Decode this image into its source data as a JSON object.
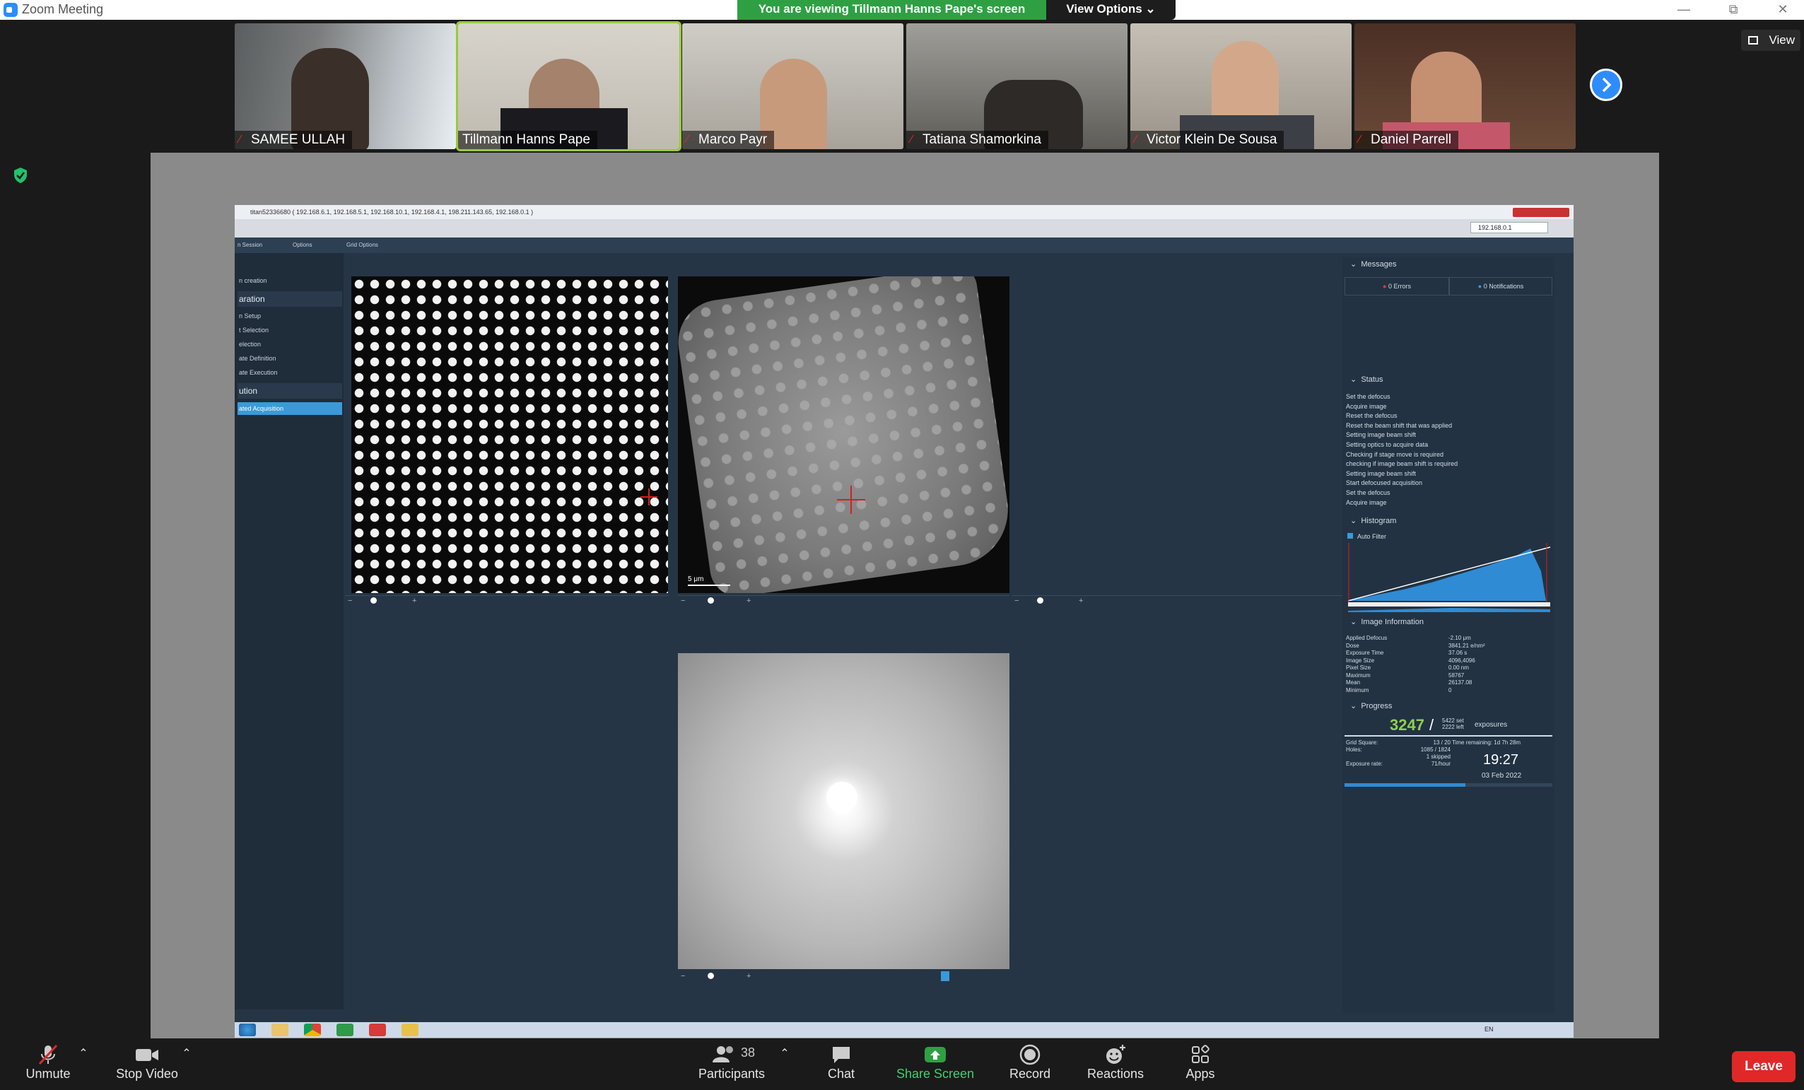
{
  "titlebar": {
    "app_title": "Zoom Meeting"
  },
  "banner": {
    "text": "You are viewing Tillmann Hanns Pape's screen",
    "view_options": "View Options ⌄"
  },
  "participants_strip": [
    {
      "name": "SAMEE ULLAH",
      "muted": true
    },
    {
      "name": "Tillmann Hanns Pape",
      "muted": false
    },
    {
      "name": "Marco Payr",
      "muted": true
    },
    {
      "name": "Tatiana Shamorkina",
      "muted": true
    },
    {
      "name": "Victor Klein De Sousa",
      "muted": true
    },
    {
      "name": "Daniel Parrell",
      "muted": true
    }
  ],
  "view_button": "View",
  "shared": {
    "window_title": "titan52336680 ( 192.168.6.1, 192.168.5.1, 192.168.10.1, 192.168.4.1, 198.211.143.65, 192.168.0.1 )",
    "ip_field": "192.168.0.1",
    "tabs": [
      "n Session",
      "Options",
      "Grid Options"
    ],
    "sidebar": [
      {
        "label": "n creation",
        "type": "item"
      },
      {
        "label": "aration",
        "type": "header"
      },
      {
        "label": "n Setup",
        "type": "item"
      },
      {
        "label": "t Selection",
        "type": "item"
      },
      {
        "label": "election",
        "type": "item"
      },
      {
        "label": "ate Definition",
        "type": "item"
      },
      {
        "label": "ate Execution",
        "type": "item"
      },
      {
        "label": "ution",
        "type": "header"
      },
      {
        "label": "ated Acquisition",
        "type": "selected"
      }
    ],
    "panel_scale_1": "5 μm",
    "messages": {
      "header": "Messages",
      "errors": "0 Errors",
      "notifications": "0 Notifications"
    },
    "status": {
      "header": "Status",
      "lines": [
        "Set the defocus",
        "Acquire image",
        "Reset the defocus",
        "Reset the beam shift that was applied",
        "Setting image beam shift",
        "Setting optics to acquire data",
        "Checking if stage move is required",
        "checking if image beam shift is required",
        "Setting image beam shift",
        "Start defocused acquisition",
        "Set the defocus",
        "Acquire image"
      ]
    },
    "histogram": {
      "header": "Histogram",
      "auto_filter": "Auto Filter"
    },
    "image_info": {
      "header": "Image Information",
      "rows": [
        {
          "k": "Applied Defocus",
          "v": "-2.10 μm"
        },
        {
          "k": "Dose",
          "v": "3841.21 e/nm²"
        },
        {
          "k": "Exposure Time",
          "v": "37.06 s"
        },
        {
          "k": "Image Size",
          "v": "4096,4096"
        },
        {
          "k": "Pixel Size",
          "v": "0.00 nm"
        },
        {
          "k": "Maximum",
          "v": "58767"
        },
        {
          "k": "Mean",
          "v": "26137.08"
        },
        {
          "k": "Minimum",
          "v": "0"
        }
      ]
    },
    "progress": {
      "header": "Progress",
      "count": "3247",
      "slash": "/",
      "total_set": "5422",
      "total_left": "2222",
      "set_label": "set",
      "left_label": "left",
      "exposures": "exposures",
      "grid_square_label": "Grid Square:",
      "grid_square": "13 / 20",
      "holes_label": "Holes:",
      "holes": "1085 / 1824",
      "skipped": "1 skipped",
      "exposure_rate_label": "Exposure rate:",
      "exposure_rate": "71/hour",
      "time_remaining": "Time remaining: 1d 7h 28m",
      "time": "19:27",
      "date": "03 Feb 2022",
      "fraction": 0.58
    },
    "taskbar_lang": "EN"
  },
  "toolbar": {
    "unmute": "Unmute",
    "stop_video": "Stop Video",
    "participants": "Participants",
    "participants_count": "38",
    "chat": "Chat",
    "share_screen": "Share Screen",
    "record": "Record",
    "reactions": "Reactions",
    "apps": "Apps",
    "leave": "Leave"
  },
  "colors": {
    "share_green": "#2ea043",
    "zoom_blue": "#2d8cff",
    "leave_red": "#e02828",
    "active_speaker": "#9bc93b"
  }
}
